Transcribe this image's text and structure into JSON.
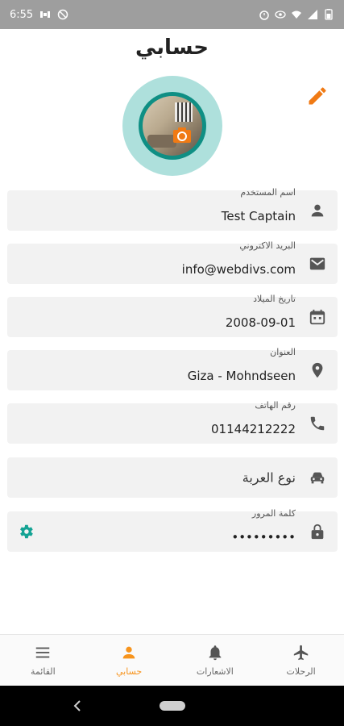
{
  "status_bar": {
    "time": "6:55"
  },
  "header": {
    "title": "حسابي"
  },
  "fields": [
    {
      "label": "اسم المستخدم",
      "value": "Test Captain",
      "icon": "person-icon"
    },
    {
      "label": "البريد الاكتروني",
      "value": "info@webdivs.com",
      "icon": "email-icon"
    },
    {
      "label": "تاريخ الميلاد",
      "value": "2008-09-01",
      "icon": "calendar-icon"
    },
    {
      "label": "العنوان",
      "value": "Giza - Mohndseen",
      "icon": "location-icon"
    },
    {
      "label": "رقم الهاتف",
      "value": "01144212222",
      "icon": "phone-icon"
    },
    {
      "label": "",
      "value": "نوع العربة",
      "icon": "car-icon"
    },
    {
      "label": "كلمة المرور",
      "value": "•••••••••",
      "icon": "lock-icon"
    }
  ],
  "bottom_nav": [
    {
      "label": "القائمة",
      "icon": "menu-icon"
    },
    {
      "label": "حسابي",
      "icon": "profile-icon",
      "active": true
    },
    {
      "label": "الاشعارات",
      "icon": "bell-icon"
    },
    {
      "label": "الرحلات",
      "icon": "airplane-icon"
    }
  ],
  "colors": {
    "accent": "#f7941d",
    "teal": "#0f8f84",
    "teal_light": "#aee0dc",
    "field_bg": "#f2f2f2",
    "icon_gray": "#555555"
  }
}
